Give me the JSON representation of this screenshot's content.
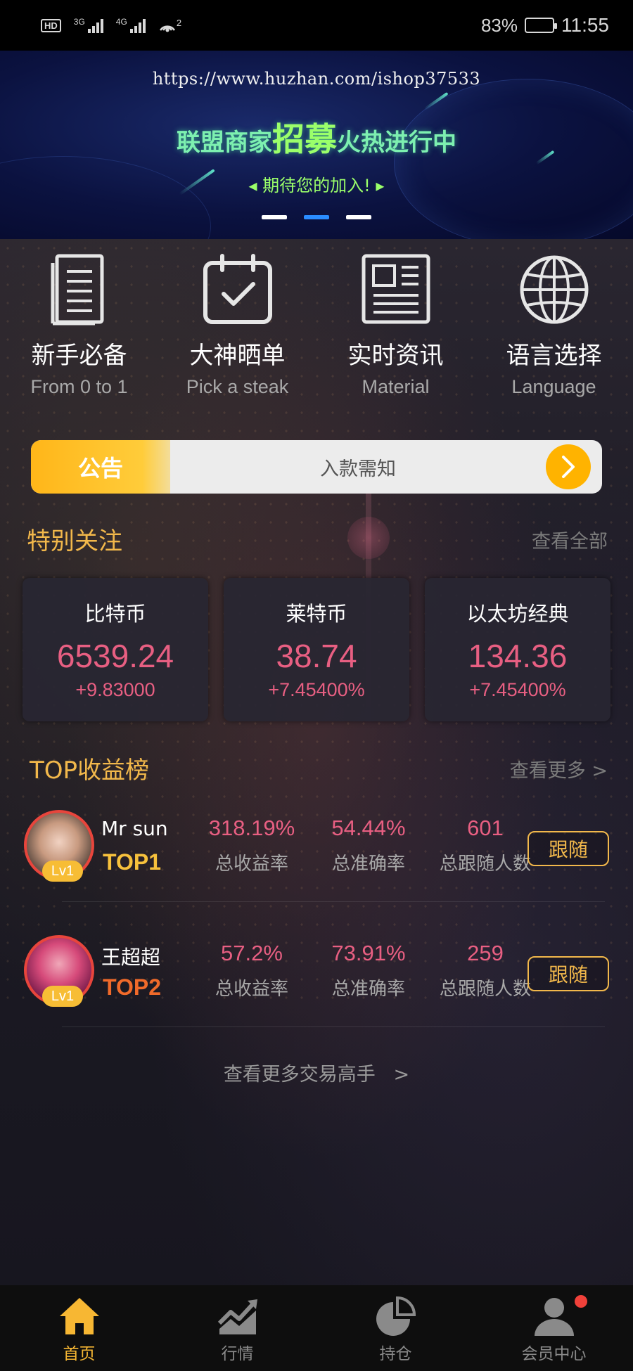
{
  "status_bar": {
    "hd": "HD",
    "net1": "3G",
    "net2": "4G",
    "hotspot_count": "2",
    "battery": "83%",
    "battery_level": 0.83,
    "time": "11:55"
  },
  "banner": {
    "url": "https://www.huzhan.com/ishop37533",
    "title_left": "联盟商家",
    "title_big": "招募",
    "title_right": "火热进行中",
    "subtitle": "◂ 期待您的加入! ▸",
    "slide_count": 3,
    "active_slide": 2
  },
  "quick_menu": [
    {
      "icon": "book-icon",
      "title": "新手必备",
      "subtitle": "From 0 to 1"
    },
    {
      "icon": "calendar-check-icon",
      "title": "大神晒单",
      "subtitle": "Pick a steak"
    },
    {
      "icon": "newspaper-icon",
      "title": "实时资讯",
      "subtitle": "Material"
    },
    {
      "icon": "globe-icon",
      "title": "语言选择",
      "subtitle": "Language"
    }
  ],
  "notice": {
    "tag": "公告",
    "text": "入款需知"
  },
  "special_focus": {
    "title": "特别关注",
    "more": "查看全部",
    "coins": [
      {
        "name": "比特币",
        "price": "6539.24",
        "change": "+9.83000"
      },
      {
        "name": "莱特币",
        "price": "38.74",
        "change": "+7.45400%"
      },
      {
        "name": "以太坊经典",
        "price": "134.36",
        "change": "+7.45400%"
      }
    ]
  },
  "leaderboard": {
    "title": "TOP收益榜",
    "more": "查看更多 >",
    "stat_labels": [
      "总收益率",
      "总准确率",
      "总跟随人数"
    ],
    "follow_label": "跟随",
    "entries": [
      {
        "name": "Mr sun",
        "rank": "TOP1",
        "level": "Lv1",
        "profit": "318.19%",
        "accuracy": "54.44%",
        "followers": "601"
      },
      {
        "name": "王超超",
        "rank": "TOP2",
        "level": "Lv1",
        "profit": "57.2%",
        "accuracy": "73.91%",
        "followers": "259"
      }
    ],
    "rank_colors": {
      "TOP1": "#f7c13c",
      "TOP2": "#f06a2a"
    },
    "see_more_traders": "查看更多交易高手   >"
  },
  "bottom_nav": [
    {
      "icon": "home-icon",
      "label": "首页",
      "active": true
    },
    {
      "icon": "chart-trend-icon",
      "label": "行情",
      "active": false
    },
    {
      "icon": "pie-chart-icon",
      "label": "持仓",
      "active": false
    },
    {
      "icon": "user-icon",
      "label": "会员中心",
      "active": false,
      "badge": true
    }
  ],
  "colors": {
    "accent": "#f2b84b",
    "price": "#e85f82",
    "active_nav": "#f7b733"
  }
}
